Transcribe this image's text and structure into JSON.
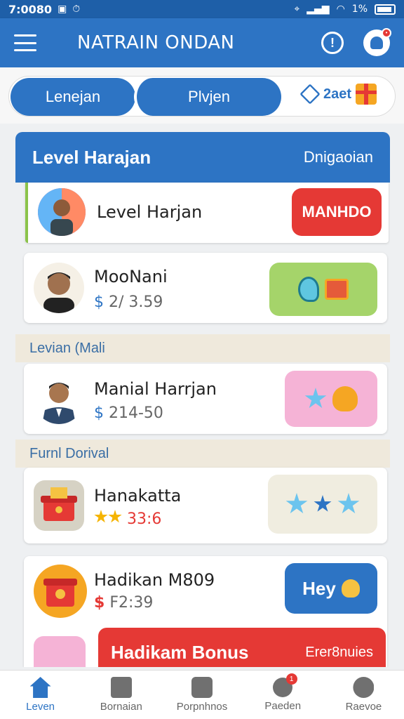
{
  "status_bar": {
    "time": "7:0080",
    "battery": "1%"
  },
  "app_bar": {
    "title": "NATRAIN ONDAN"
  },
  "tabs": [
    {
      "label": "Lenejan"
    },
    {
      "label": "Plvjen"
    },
    {
      "label": "2aet"
    }
  ],
  "panel": {
    "title": "Level Harajan",
    "right_text": "Dnigaoian"
  },
  "rows": [
    {
      "name": "Level Harjan",
      "action": "MANHDO"
    },
    {
      "name": "MooNani",
      "currency": "$",
      "value": "2/ 3.59"
    },
    {
      "name": "Manial Harrjan",
      "currency": "$",
      "value": "214-50"
    },
    {
      "name": "Hanakatta",
      "value": "33:6"
    },
    {
      "name": "Hadikan M809",
      "currency": "$",
      "value": "F2:39",
      "action": "Hey"
    }
  ],
  "section_labels": [
    "Levian (Mali",
    "Furnl Dorival"
  ],
  "bonus": {
    "title": "Hadikam Bonus",
    "right": "Erer8nuies"
  },
  "bottom_nav": [
    {
      "label": "Leven",
      "icon": "home-icon",
      "active": true
    },
    {
      "label": "Bornaian",
      "icon": "note-icon"
    },
    {
      "label": "Porpnhnos",
      "icon": "chat-icon"
    },
    {
      "label": "Paeden",
      "icon": "search-icon",
      "badge": "1"
    },
    {
      "label": "Raevoe",
      "icon": "user-icon"
    }
  ],
  "colors": {
    "primary": "#2d74c4",
    "danger": "#e53935",
    "accent": "#f5a623"
  }
}
